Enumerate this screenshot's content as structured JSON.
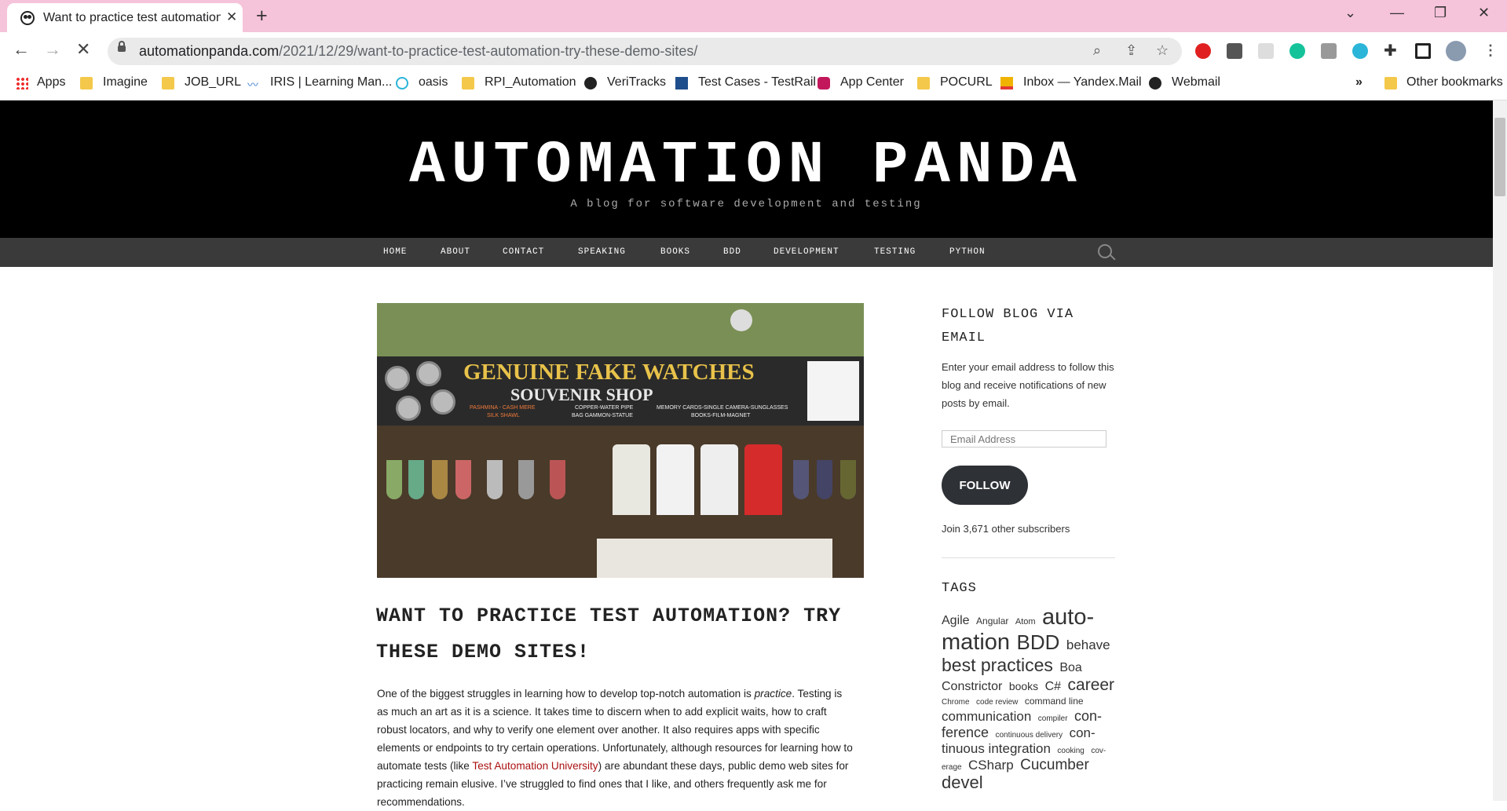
{
  "browser": {
    "tab_title": "Want to practice test automation",
    "url_domain": "automationpanda.com",
    "url_path": "/2021/12/29/want-to-practice-test-automation-try-these-demo-sites/",
    "bookmarks": [
      {
        "label": "Apps",
        "icon": "apps-grid-icon"
      },
      {
        "label": "Imagine",
        "icon": "folder-icon"
      },
      {
        "label": "JOB_URL",
        "icon": "folder-icon"
      },
      {
        "label": "IRIS | Learning Man...",
        "icon": "iris-icon"
      },
      {
        "label": "oasis",
        "icon": "oasis-icon"
      },
      {
        "label": "RPI_Automation",
        "icon": "folder-icon"
      },
      {
        "label": "VeriTracks",
        "icon": "globe-icon"
      },
      {
        "label": "Test Cases - TestRail",
        "icon": "testrail-icon"
      },
      {
        "label": "App Center",
        "icon": "appcenter-icon"
      },
      {
        "label": "POCURL",
        "icon": "folder-icon"
      },
      {
        "label": "Inbox — Yandex.Mail",
        "icon": "mail-icon"
      },
      {
        "label": "Webmail",
        "icon": "webmail-icon"
      }
    ],
    "more_bookmarks": "»",
    "other_bookmarks": "Other bookmarks"
  },
  "site": {
    "title": "AUTOMATION PANDA",
    "tagline": "A blog for software development and testing",
    "nav": [
      "HOME",
      "ABOUT",
      "CONTACT",
      "SPEAKING",
      "BOOKS",
      "BDD",
      "DEVELOPMENT",
      "TESTING",
      "PYTHON"
    ]
  },
  "hero": {
    "banner_line1": "GENUINE FAKE WATCHES",
    "banner_line2": "SOUVENIR SHOP",
    "small_left": "PASHMINA - CASH MERE",
    "small_left2": "SILK SHAWL",
    "small_mid": "COPPER-WATER PIPE",
    "small_mid2": "BAG GAMMON-STATUE",
    "small_right": "MEMORY CARDS-SINGLE CAMERA-SUNGLASSES",
    "small_right2": "BOOKS-FILM-MAGNET"
  },
  "post": {
    "title": "WANT TO PRACTICE TEST AUTOMATION? TRY THESE DEMO SITES!",
    "body_1": "One of the biggest struggles in learning how to develop top-notch automation is ",
    "body_em": "practice",
    "body_2": ". Testing is as much an art as it is a science. It takes time to discern when to add explicit waits, how to craft robust locators, and why to verify one element over another. It also requires apps with specific elements or endpoints to try certain operations. Unfortunately, although resources for learning how to automate tests (like ",
    "body_link": "Test Automation University",
    "body_3": ") are abundant these days, public demo web sites for practicing remain elusive. I’ve struggled to find ones that I like, and others frequently ask me for recommendations."
  },
  "sidebar": {
    "follow_heading": "FOLLOW BLOG VIA EMAIL",
    "follow_text": "Enter your email address to follow this blog and receive notifications of new posts by email.",
    "email_placeholder": "Email Address",
    "follow_button": "FOLLOW",
    "subscribers": "Join 3,671 other subscribers",
    "tags_heading": "TAGS",
    "tags": [
      {
        "label": "Agile",
        "size": 16
      },
      {
        "label": "Angular",
        "size": 12
      },
      {
        "label": "Atom",
        "size": 11
      },
      {
        "label": "auto-mation",
        "size": 29
      },
      {
        "label": "BDD",
        "size": 26
      },
      {
        "label": "behave",
        "size": 17
      },
      {
        "label": "best practices",
        "size": 23
      },
      {
        "label": "Boa Constrictor",
        "size": 16
      },
      {
        "label": "books",
        "size": 14
      },
      {
        "label": "C#",
        "size": 16
      },
      {
        "label": "career",
        "size": 21
      },
      {
        "label": "Chrome",
        "size": 10
      },
      {
        "label": "code review",
        "size": 10
      },
      {
        "label": "command line",
        "size": 12
      },
      {
        "label": "communication",
        "size": 17
      },
      {
        "label": "compiler",
        "size": 10
      },
      {
        "label": "con-ference",
        "size": 18
      },
      {
        "label": "continuous delivery",
        "size": 10
      },
      {
        "label": "con-tinuous integration",
        "size": 17
      },
      {
        "label": "cooking",
        "size": 10
      },
      {
        "label": "cov-erage",
        "size": 10
      },
      {
        "label": "CSharp",
        "size": 17
      },
      {
        "label": "Cucumber",
        "size": 19
      },
      {
        "label": "devel",
        "size": 22
      }
    ]
  },
  "colors": {
    "tab_strip": "#f5c3da",
    "site_header": "#000000",
    "nav_bar": "#3a3a3a",
    "link": "#aa1111",
    "follow_button": "#2e3135"
  }
}
